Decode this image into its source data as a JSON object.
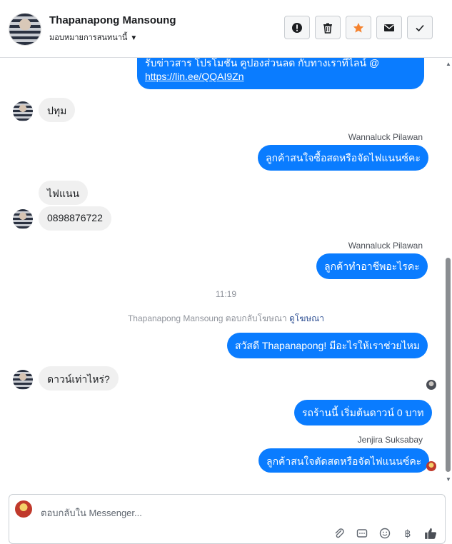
{
  "header": {
    "name": "Thapanapong Mansoung",
    "subtitle": "มอบหมายการสนทนานี้"
  },
  "messages": {
    "m1_line1": "รับข่าวสาร  โปรโมชั่น คูปองส่วนลด กับทางเราที่ไลน์ @",
    "m1_link": "https://lin.ee/QQAI9Zn",
    "m2": "ปทุม",
    "sender1": "Wannaluck Pilawan",
    "m3": "ลูกค้าสนใจซื้อสดหรือจัดไฟแนนซ์คะ",
    "m4": "ไฟแนน",
    "m5": "0898876722",
    "sender2": "Wannaluck Pilawan",
    "m6": "ลูกค้าทำอาชีพอะไรคะ",
    "time": "11:19",
    "ad_reply_text": "Thapanapong Mansoung ตอบกลับโฆษณา",
    "ad_reply_link": "ดูโฆษณา",
    "m7": "สวัสดี Thapanapong! มีอะไรให้เราช่วยไหม",
    "m8": "ดาวน์เท่าไหร่?",
    "m9": "รถร้านนี้ เริ่มต้นดาวน์ 0 บาท",
    "sender3": "Jenjira Suksabay",
    "m10": "ลูกค้าสนใจตัดสดหรือจัดไฟแนนซ์คะ"
  },
  "composer": {
    "placeholder": "ตอบกลับใน Messenger..."
  },
  "colors": {
    "outgoing": "#0a7cff",
    "incoming": "#f0f0f0",
    "star": "#f5822e"
  },
  "icons": [
    "alert-icon",
    "trash-icon",
    "star-icon",
    "mail-icon",
    "check-icon",
    "attach-icon",
    "gif-icon",
    "emoji-icon",
    "currency-icon",
    "like-icon"
  ]
}
